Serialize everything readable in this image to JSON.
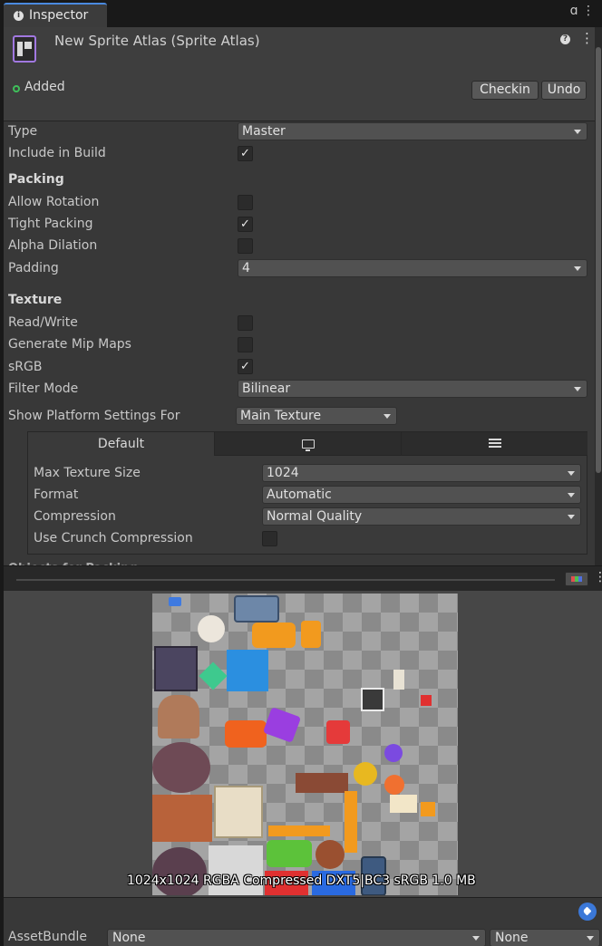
{
  "tab": {
    "title": "Inspector",
    "lock_glyph": "ɑ̣",
    "kebab_glyph": "⋮"
  },
  "header": {
    "title": "New Sprite Atlas (Sprite Atlas)",
    "help_glyph": "?",
    "kebab_glyph": "⋮",
    "vc_status": "Added",
    "checkin_label": "Checkin",
    "undo_label": "Undo"
  },
  "fields": {
    "type": {
      "label": "Type",
      "value": "Master"
    },
    "include_in_build": {
      "label": "Include in Build",
      "checked": true
    },
    "packing_header": "Packing",
    "allow_rotation": {
      "label": "Allow Rotation",
      "checked": false
    },
    "tight_packing": {
      "label": "Tight Packing",
      "checked": true
    },
    "alpha_dilation": {
      "label": "Alpha Dilation",
      "checked": false
    },
    "padding": {
      "label": "Padding",
      "value": "4"
    },
    "texture_header": "Texture",
    "read_write": {
      "label": "Read/Write",
      "checked": false
    },
    "generate_mip_maps": {
      "label": "Generate Mip Maps",
      "checked": false
    },
    "srgb": {
      "label": "sRGB",
      "checked": true
    },
    "filter_mode": {
      "label": "Filter Mode",
      "value": "Bilinear"
    },
    "platform_settings": {
      "label": "Show Platform Settings For",
      "value": "Main Texture"
    }
  },
  "platform": {
    "tabs": [
      "Default",
      "monitor-icon",
      "sliders-icon"
    ],
    "max_texture_size": {
      "label": "Max Texture Size",
      "value": "1024"
    },
    "format": {
      "label": "Format",
      "value": "Automatic"
    },
    "compression": {
      "label": "Compression",
      "value": "Normal Quality"
    },
    "use_crunch": {
      "label": "Use Crunch Compression",
      "checked": false
    }
  },
  "objects_label": "Objects for Packing",
  "preview": {
    "info": "1024x1024 RGBA Compressed DXT5|BC3 sRGB   1.0 MB",
    "kebab_glyph": "⋮"
  },
  "bottom": {
    "assetbundle_label": "AssetBundle",
    "bundle_value": "None",
    "variant_value": "None"
  },
  "colors": {
    "accent": "#4a8ae0",
    "atlas_icon": "#a178e0",
    "added_status": "#3fbf5a",
    "tag": "#3b78d8"
  },
  "check_glyph": "✓"
}
